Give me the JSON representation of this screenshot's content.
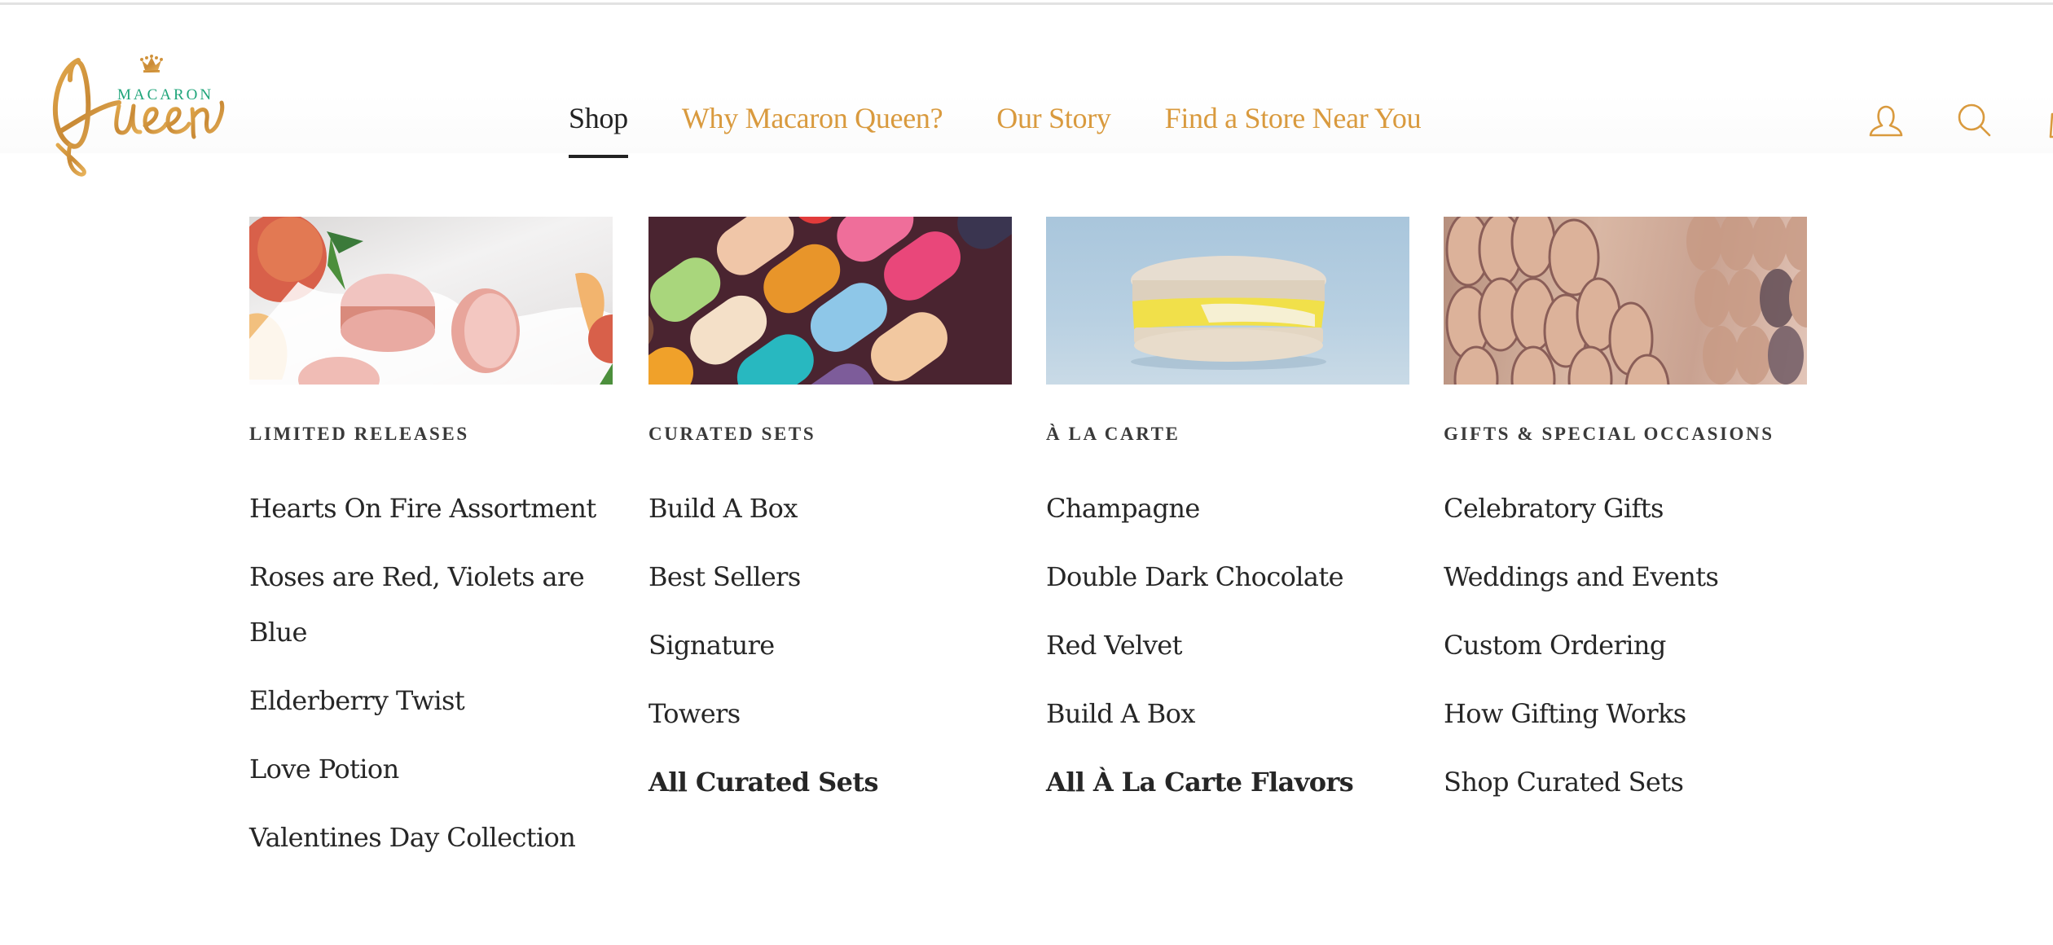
{
  "brand": {
    "name_top": "MACARON",
    "name_script": "Queen",
    "logo_icon": "crown-icon",
    "colors": {
      "gold": "#d99a3e",
      "green": "#1fa57a",
      "text_dark": "#262626"
    }
  },
  "nav": {
    "items": [
      {
        "label": "Shop",
        "active": true
      },
      {
        "label": "Why Macaron Queen?",
        "active": false
      },
      {
        "label": "Our Story",
        "active": false
      },
      {
        "label": "Find a Store Near You",
        "active": false
      }
    ]
  },
  "header_icons": [
    {
      "name": "account-icon",
      "label": "Account"
    },
    {
      "name": "search-icon",
      "label": "Search"
    },
    {
      "name": "shopping-bag-icon",
      "label": "Cart"
    }
  ],
  "mega_menu": {
    "columns": [
      {
        "heading": "LIMITED RELEASES",
        "image": "peach macarons with milk splash",
        "items": [
          {
            "label": "Hearts On Fire Assortment",
            "bold": false
          },
          {
            "label": "Roses are Red, Violets are Blue",
            "bold": false
          },
          {
            "label": "Elderberry Twist",
            "bold": false
          },
          {
            "label": "Love Potion",
            "bold": false
          },
          {
            "label": "Valentines Day Collection",
            "bold": false
          }
        ]
      },
      {
        "heading": "CURATED SETS",
        "image": "rows of colorful macarons",
        "items": [
          {
            "label": "Build A Box",
            "bold": false
          },
          {
            "label": "Best Sellers",
            "bold": false
          },
          {
            "label": "Signature",
            "bold": false
          },
          {
            "label": "Towers",
            "bold": false
          },
          {
            "label": "All Curated Sets",
            "bold": true
          }
        ]
      },
      {
        "heading": "À LA CARTE",
        "image": "single champagne macaron on blue background",
        "items": [
          {
            "label": "Champagne",
            "bold": false
          },
          {
            "label": "Double Dark Chocolate",
            "bold": false
          },
          {
            "label": "Red Velvet",
            "bold": false
          },
          {
            "label": "Build A Box",
            "bold": false
          },
          {
            "label": "All À La Carte Flavors",
            "bold": true
          }
        ]
      },
      {
        "heading": "GIFTS & SPECIAL OCCASIONS",
        "image": "macaron tower display",
        "items": [
          {
            "label": "Celebratory Gifts",
            "bold": false
          },
          {
            "label": "Weddings and Events",
            "bold": false
          },
          {
            "label": "Custom Ordering",
            "bold": false
          },
          {
            "label": "How Gifting Works",
            "bold": false
          },
          {
            "label": "Shop Curated Sets",
            "bold": false
          }
        ]
      }
    ]
  }
}
